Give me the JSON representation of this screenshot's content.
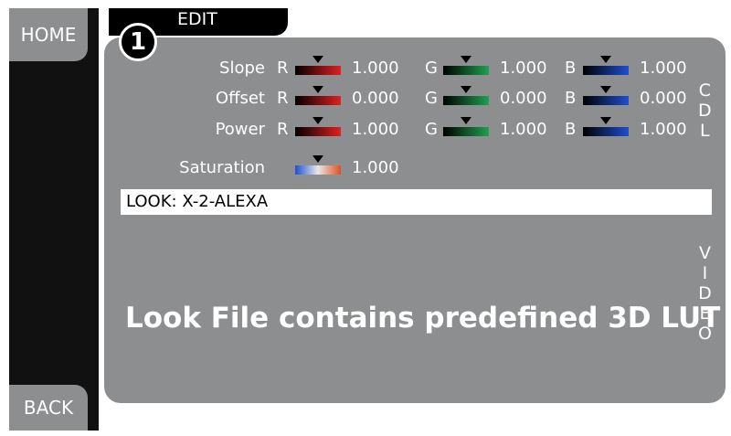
{
  "sidebar": {
    "home_label": "HOME",
    "back_label": "BACK"
  },
  "header": {
    "tab_label": "EDIT",
    "badge": "1"
  },
  "cdl": {
    "rows": [
      {
        "name": "Slope",
        "r": "1.000",
        "g": "1.000",
        "b": "1.000"
      },
      {
        "name": "Offset",
        "r": "0.000",
        "g": "0.000",
        "b": "0.000"
      },
      {
        "name": "Power",
        "r": "1.000",
        "g": "1.000",
        "b": "1.000"
      }
    ],
    "channel_labels": {
      "r": "R",
      "g": "G",
      "b": "B"
    },
    "saturation": {
      "label": "Saturation",
      "value": "1.000"
    },
    "side_label": [
      "C",
      "D",
      "L"
    ]
  },
  "look": {
    "label": "LOOK: X-2-ALEXA"
  },
  "video": {
    "message": "Look File contains predefined 3D LUT",
    "side_label": [
      "V",
      "I",
      "D",
      "E",
      "O"
    ]
  },
  "colors": {
    "red": "#e02020",
    "green": "#1fa050",
    "blue": "#1e4fd0",
    "panel": "#8d8e8f"
  }
}
